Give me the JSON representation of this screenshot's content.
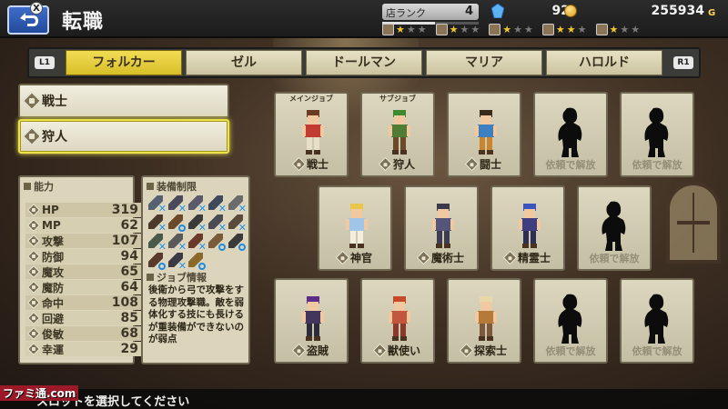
{
  "header": {
    "title": "転職",
    "x_badge": "X"
  },
  "shop": {
    "rank_label": "店ランク",
    "rank_value": "4",
    "rank_progress": 0.55,
    "gems": "92",
    "gold": "255934",
    "gold_unit": "G",
    "skills": [
      {
        "icon": "pickaxe-icon",
        "stars": 1
      },
      {
        "icon": "pot-icon",
        "stars": 1
      },
      {
        "icon": "saw-icon",
        "stars": 1
      },
      {
        "icon": "loom-icon",
        "stars": 2
      },
      {
        "icon": "scroll-icon",
        "stars": 1
      }
    ]
  },
  "tabs": {
    "left_button": "L1",
    "right_button": "R1",
    "items": [
      "フォルカー",
      "ゼル",
      "ドールマン",
      "マリア",
      "ハロルド"
    ],
    "active_index": 0
  },
  "slots": [
    {
      "label": "戦士",
      "selected": false
    },
    {
      "label": "狩人",
      "selected": true
    }
  ],
  "abilities": {
    "title": "能力",
    "rows": [
      {
        "label": "HP",
        "value": "319"
      },
      {
        "label": "MP",
        "value": "62"
      },
      {
        "label": "攻撃",
        "value": "107"
      },
      {
        "label": "防御",
        "value": "94"
      },
      {
        "label": "魔攻",
        "value": "65"
      },
      {
        "label": "魔防",
        "value": "64"
      },
      {
        "label": "命中",
        "value": "108"
      },
      {
        "label": "回避",
        "value": "85"
      },
      {
        "label": "俊敏",
        "value": "68"
      },
      {
        "label": "幸運",
        "value": "29"
      }
    ]
  },
  "equipment": {
    "title": "装備制限",
    "job_info_title": "ジョブ情報",
    "job_info_text": "後衛から弓で攻撃をする物理攻撃職。敵を弱体化する技にも長けるが重装備ができないのが弱点"
  },
  "jobs": [
    {
      "label": "戦士",
      "tag": "メインジョブ",
      "locked": false,
      "palette": {
        "hair": "#6b3a22",
        "body": "#c23b32",
        "legs": "#e8dfc8"
      }
    },
    {
      "label": "狩人",
      "tag": "サブジョブ",
      "locked": false,
      "palette": {
        "hair": "#3c8a2e",
        "body": "#4f7d36",
        "legs": "#6b4a2a"
      }
    },
    {
      "label": "闘士",
      "tag": "",
      "locked": false,
      "palette": {
        "hair": "#3a2a1a",
        "body": "#3d7fbf",
        "legs": "#c9862e"
      }
    },
    {
      "label": "依頼で解放",
      "tag": "",
      "locked": true
    },
    {
      "label": "依頼で解放",
      "tag": "",
      "locked": true
    },
    {
      "label": "神官",
      "tag": "",
      "locked": false,
      "palette": {
        "hair": "#e8c64a",
        "body": "#9fc6e8",
        "legs": "#f2efe0"
      }
    },
    {
      "label": "魔術士",
      "tag": "",
      "locked": false,
      "palette": {
        "hair": "#3a3a4a",
        "body": "#55557a",
        "legs": "#3c3c52"
      }
    },
    {
      "label": "精霊士",
      "tag": "",
      "locked": false,
      "palette": {
        "hair": "#3a55c0",
        "body": "#3f3f80",
        "legs": "#2e2e55"
      }
    },
    {
      "label": "依頼で解放",
      "tag": "",
      "locked": true
    },
    {
      "label": "盗賊",
      "tag": "",
      "locked": false,
      "palette": {
        "hair": "#5c2e8a",
        "body": "#43355c",
        "legs": "#2c2c3c"
      }
    },
    {
      "label": "獣使い",
      "tag": "",
      "locked": false,
      "palette": {
        "hair": "#c44a2a",
        "body": "#c2573d",
        "legs": "#8a3a2a"
      }
    },
    {
      "label": "探索士",
      "tag": "",
      "locked": false,
      "palette": {
        "hair": "#e8d8a8",
        "body": "#b57a3a",
        "legs": "#7a5a3a"
      }
    },
    {
      "label": "依頼で解放",
      "tag": "",
      "locked": true
    },
    {
      "label": "依頼で解放",
      "tag": "",
      "locked": true
    }
  ],
  "footer": {
    "instruction": "スロットを選択してください",
    "watermark": "ファミ通.com"
  }
}
